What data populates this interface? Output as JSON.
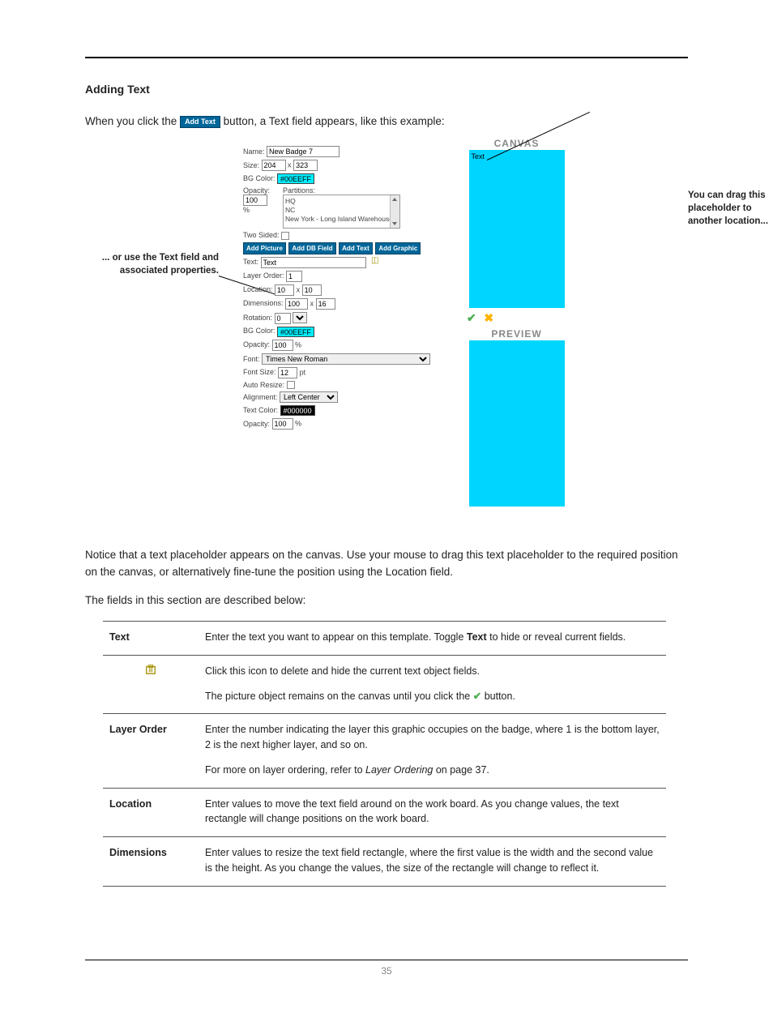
{
  "heading": "Adding Text",
  "intro_before": "When you click the ",
  "intro_button": "Add Text",
  "intro_after": " button, a Text field appears, like this example:",
  "annotation_left": "... or use the Text field and associated properties.",
  "annotation_right": "You can drag this placeholder to another location...",
  "canvas_label": "CANVAS",
  "preview_label": "PREVIEW",
  "canvas_text": "Text",
  "panel": {
    "name_label": "Name:",
    "name_value": "New Badge 7",
    "size_label": "Size:",
    "size_w": "204",
    "size_x": "x",
    "size_h": "323",
    "bgcolor_label": "BG Color:",
    "bgcolor_value": "#00EEFF",
    "opacity_label": "Opacity:",
    "opacity_value": "100",
    "opacity_unit": "%",
    "partitions_label": "Partitions:",
    "partitions": [
      "HQ",
      "NC",
      "New York - Long Island Warehouse"
    ],
    "twosided_label": "Two Sided:",
    "buttons": [
      "Add Picture",
      "Add DB Field",
      "Add Text",
      "Add Graphic"
    ],
    "text_label": "Text:",
    "text_value": "Text",
    "layer_label": "Layer Order:",
    "layer_value": "1",
    "location_label": "Location:",
    "location_x": "10",
    "location_y": "10",
    "dimensions_label": "Dimensions:",
    "dim_w": "100",
    "dim_h": "16",
    "rotation_label": "Rotation:",
    "rotation_value": "0",
    "bgcolor2_label": "BG Color:",
    "bgcolor2_value": "#00EEFF",
    "opacity2_label": "Opacity:",
    "opacity2_value": "100",
    "font_label": "Font:",
    "font_value": "Times New Roman",
    "fontsize_label": "Font Size:",
    "fontsize_value": "12",
    "fontsize_unit": "pt",
    "autoresize_label": "Auto Resize:",
    "alignment_label": "Alignment:",
    "alignment_value": "Left Center",
    "textcolor_label": "Text Color:",
    "textcolor_value": "#000000",
    "opacity3_label": "Opacity:",
    "opacity3_value": "100"
  },
  "para1": "Notice that a text placeholder appears on the canvas. Use your mouse to drag this text placeholder to the required position on the canvas, or alternatively fine-tune the position using the Location field.",
  "para2": "The fields in this section are described below:",
  "table": [
    {
      "label": "Text",
      "paras": [
        {
          "prefix": "Enter the text you want to appear on this template. Toggle ",
          "bold": "Text",
          "suffix": " to hide or reveal current fields."
        }
      ]
    },
    {
      "label": "__ICON__",
      "paras": [
        {
          "text": "Click this icon to delete and hide the current text object fields."
        },
        {
          "prefix": "The picture object remains on the canvas until you click the ",
          "check": "✔",
          "suffix": " button."
        }
      ]
    },
    {
      "label": "Layer Order",
      "paras": [
        {
          "text": "Enter the number indicating the layer this graphic occupies on the badge, where 1 is the bottom layer, 2 is the next higher layer, and so on."
        },
        {
          "prefix": "For more on layer ordering, refer to ",
          "italic": "Layer Ordering",
          "suffix": " on page 37."
        }
      ]
    },
    {
      "label": "Location",
      "paras": [
        {
          "text": "Enter values to move the text field around on the work board. As you change values, the text rectangle will change positions on the work board."
        }
      ]
    },
    {
      "label": "Dimensions",
      "paras": [
        {
          "text": "Enter values to resize the text field rectangle, where the first value is the width and the second value is the height. As you change the values, the size of the rectangle will change to reflect it."
        }
      ]
    }
  ],
  "page_number": "35"
}
